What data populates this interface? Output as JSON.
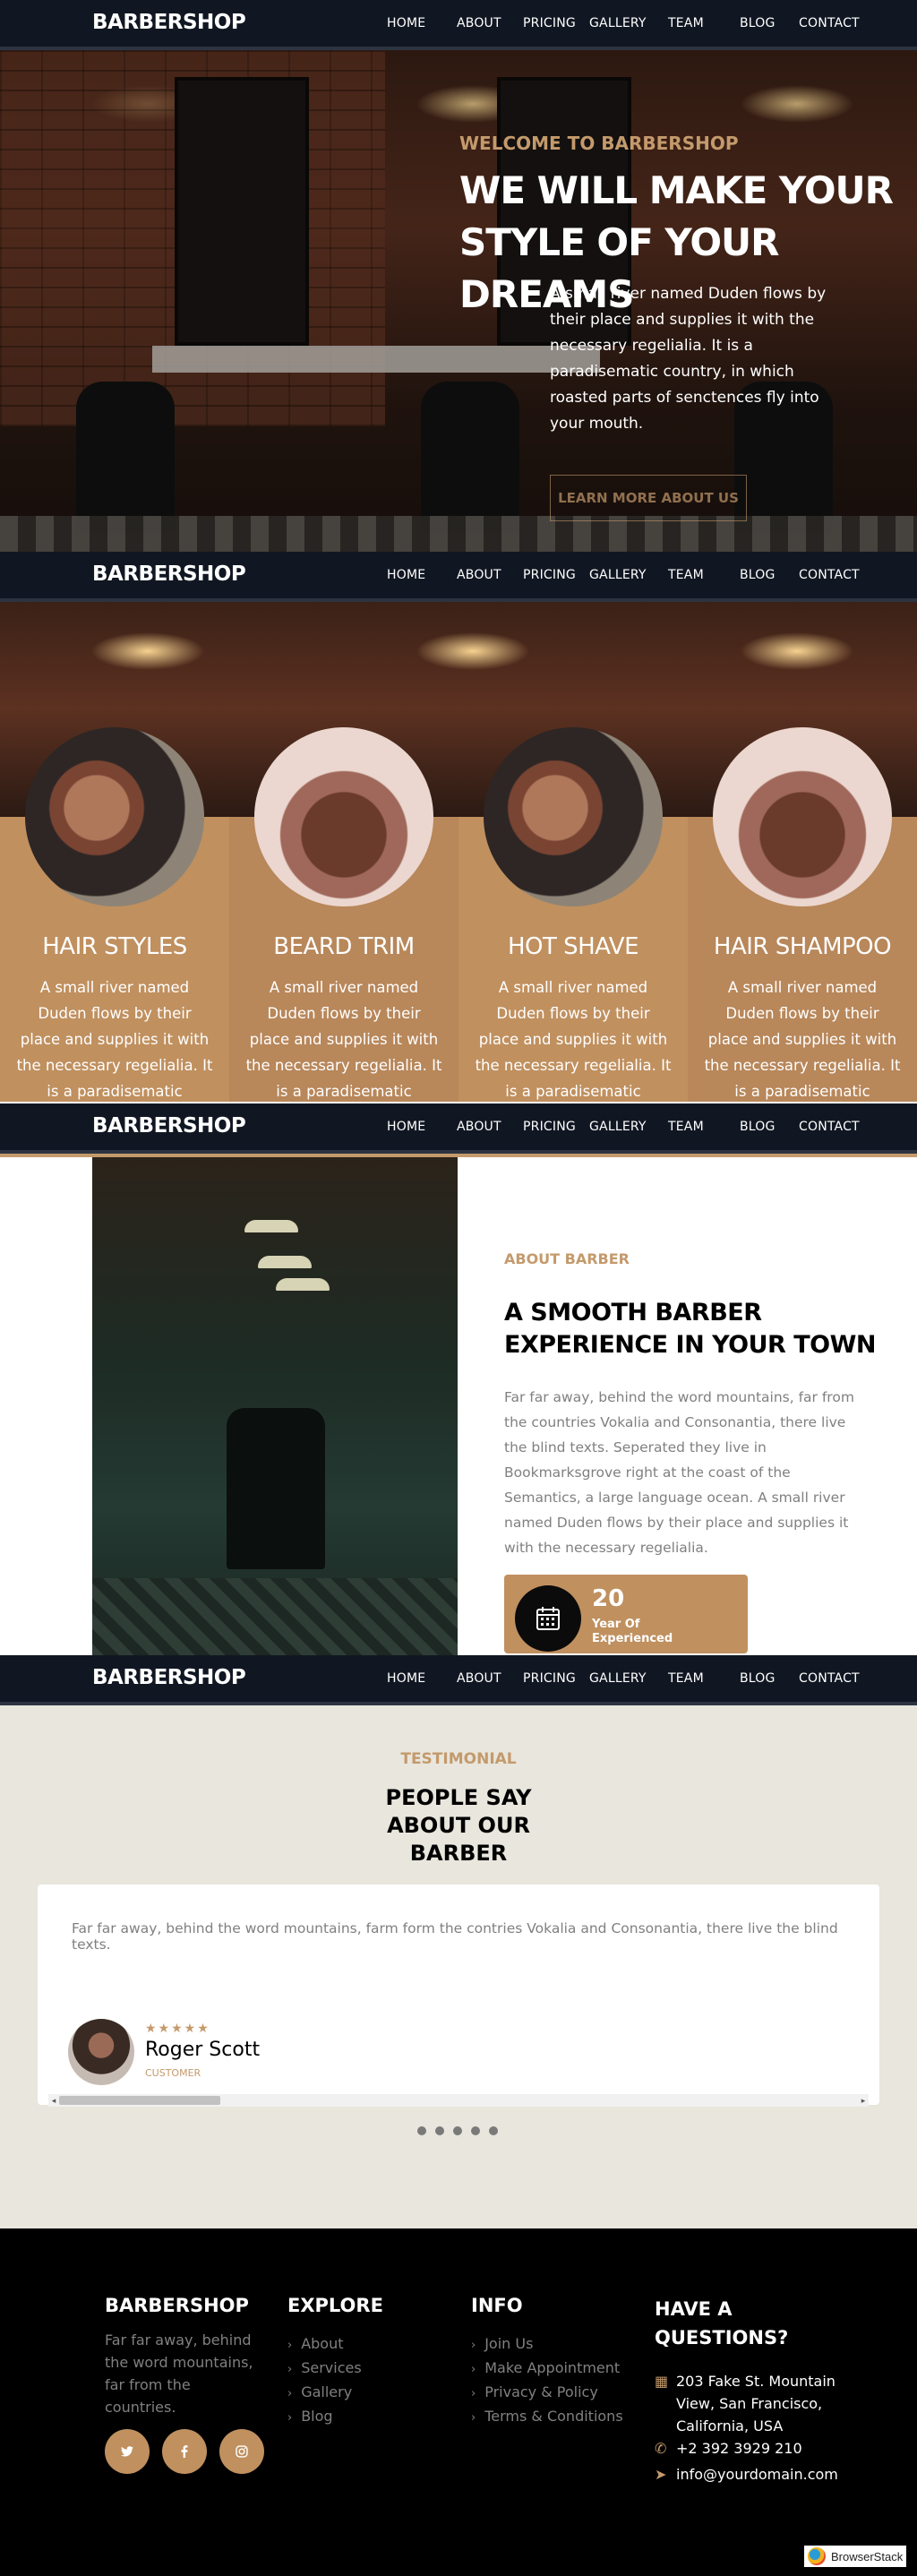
{
  "navbar": {
    "brand": "BARBERSHOP",
    "items": [
      "HOME",
      "ABOUT",
      "PRICING",
      "GALLERY",
      "TEAM",
      "BLOG",
      "CONTACT"
    ]
  },
  "hero": {
    "welcome": "WELCOME TO BARBERSHOP",
    "title": "WE WILL MAKE YOUR STYLE OF YOUR DREAMS",
    "description": "A small river named Duden flows by their place and supplies it with the necessary regelialia. It is a paradisematic country, in which roasted parts of senctences fly into your mouth.",
    "cta": "LEARN MORE ABOUT US"
  },
  "services": [
    {
      "title": "HAIR STYLES",
      "text": "A small river named Duden flows by their place and supplies it with the necessary regelialia. It is a paradisematic country, in"
    },
    {
      "title": "BEARD TRIM",
      "text": "A small river named Duden flows by their place and supplies it with the necessary regelialia. It is a paradisematic country, in"
    },
    {
      "title": "HOT SHAVE",
      "text": "A small river named Duden flows by their place and supplies it with the necessary regelialia. It is a paradisematic country, in"
    },
    {
      "title": "HAIR SHAMPOO",
      "text": "A small river named Duden flows by their place and supplies it with the necessary regelialia. It is a paradisematic country, in"
    }
  ],
  "about": {
    "kicker": "ABOUT BARBER",
    "title": "A SMOOTH BARBER EXPERIENCE IN YOUR TOWN",
    "text": "Far far away, behind the word mountains, far from the countries Vokalia and Consonantia, there live the blind texts. Seperated they live in Bookmarksgrove right at the coast of the Semantics, a large language ocean. A small river named Duden flows by their place and supplies it with the necessary regelialia.",
    "experience_number": "20",
    "experience_label": "Year Of Experienced"
  },
  "testimonial": {
    "kicker": "TESTIMONIAL",
    "title": "PEOPLE SAY ABOUT OUR BARBER",
    "quote": "Far far away, behind the word mountains, farm form the contries Vokalia and Consonantia, there live the blind texts.",
    "stars": "★★★★★",
    "name": "Roger Scott",
    "role": "CUSTOMER",
    "dots": 5
  },
  "footer": {
    "brand": "BARBERSHOP",
    "brand_text": "Far far away, behind the word mountains, far from the countries.",
    "explore_title": "EXPLORE",
    "explore": [
      "About",
      "Services",
      "Gallery",
      "Blog"
    ],
    "info_title": "INFO",
    "info": [
      "Join Us",
      "Make Appointment",
      "Privacy & Policy",
      "Terms & Conditions"
    ],
    "questions_title": "HAVE A QUESTIONS?",
    "address": "203 Fake St. Mountain View, San Francisco, California, USA",
    "phone": "+2 392 3929 210",
    "email": "info@yourdomain.com",
    "social_icons": [
      "twitter-icon",
      "facebook-icon",
      "instagram-icon"
    ]
  },
  "badge": {
    "label": "BrowserStack"
  },
  "colors": {
    "accent": "#c49a6c",
    "nav_bg": "#111722",
    "footer_bg": "#000000",
    "testimonial_bg": "#e8e6dd"
  }
}
